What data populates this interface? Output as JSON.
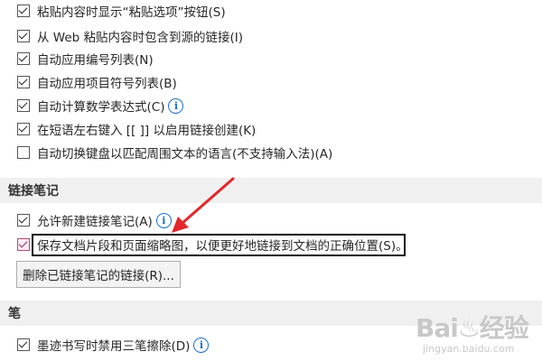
{
  "options": {
    "paste_option": "粘贴内容时显示“粘贴选项”按钮(S)",
    "web_paste": "从 Web 粘贴内容时包含到源的链接(I)",
    "auto_numbered": "自动应用编号列表(N)",
    "auto_bulleted": "自动应用项目符号列表(B)",
    "math_expr": "自动计算数学表达式(C)",
    "link_create": "在短语左右键入 [[  ]] 以启用链接创建(K)",
    "keyboard_switch": "自动切换键盘以匹配周围文本的语言(不支持输入法)(A)"
  },
  "linked_notes": {
    "section_title": "链接笔记",
    "allow_new": "允许新建链接笔记(A)",
    "save_snippets": "保存文档片段和页面缩略图，以便更好地链接到文档的正确位置(S)。",
    "delete_button": "删除已链接笔记的链接(R)..."
  },
  "pen": {
    "section_title": "笔",
    "ink_option": "墨迹书写时禁用三笔擦除(D)"
  },
  "icons": {
    "info": "i"
  },
  "annotation": {
    "arrow_color": "#e3262b",
    "box_color": "#111111"
  },
  "watermark": {
    "main": "Bai♨经验",
    "sub": "jingyan.baidu.com"
  }
}
